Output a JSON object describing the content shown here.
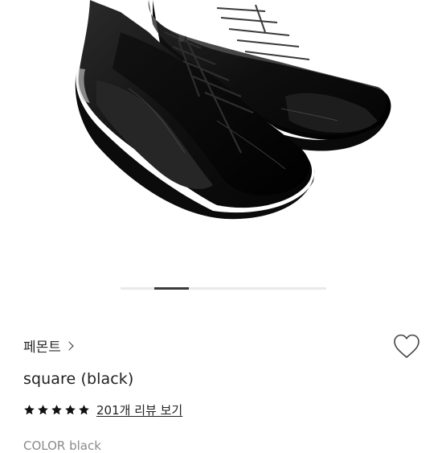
{
  "product": {
    "image_alt": "black suede and leather sneakers",
    "brand": "페몬트",
    "title": "square (black)",
    "rating": {
      "stars_filled": 5,
      "stars_total": 5,
      "review_link": "201개 리뷰 보기"
    },
    "cut_off_text": "COLOR black"
  },
  "carousel": {
    "current_index": 2,
    "total": 6
  },
  "icons": {
    "heart": "heart-outline-icon",
    "chevron": "chevron-right-icon",
    "star": "star-filled-icon"
  }
}
